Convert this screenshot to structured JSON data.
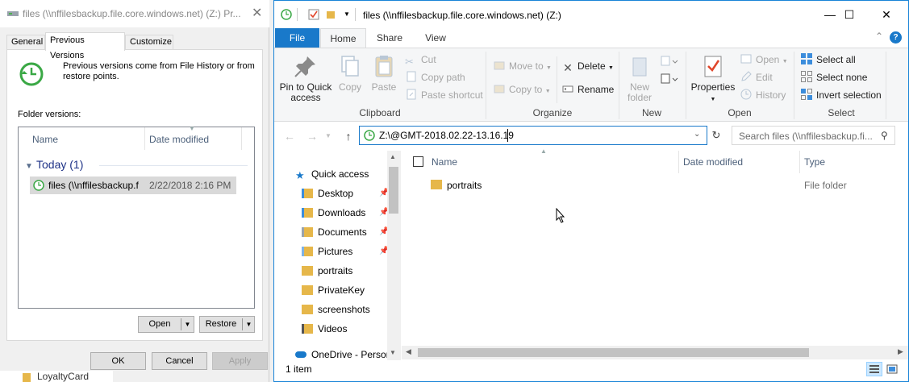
{
  "props": {
    "title": "files (\\\\nffilesbackup.file.core.windows.net) (Z:) Pr...",
    "tabs": [
      {
        "label": "General"
      },
      {
        "label": "Previous Versions"
      },
      {
        "label": "Customize"
      }
    ],
    "description": "Previous versions come from File History or from restore points.",
    "folder_versions_label": "Folder versions:",
    "columns": {
      "name": "Name",
      "date": "Date modified"
    },
    "group": {
      "label": "Today (1)"
    },
    "version_row": {
      "name": "files (\\\\nffilesbackup.file.core.windows.net)",
      "date": "2/22/2018 2:16 PM"
    },
    "open_label": "Open",
    "restore_label": "Restore",
    "ok_label": "OK",
    "cancel_label": "Cancel",
    "apply_label": "Apply",
    "under_label": "LoyaltyCard"
  },
  "explorer": {
    "title": "files (\\\\nffilesbackup.file.core.windows.net) (Z:)",
    "window_buttons": {
      "minimize": "—",
      "maximize": "☐",
      "close": "✕"
    },
    "tabs": [
      {
        "label": "File"
      },
      {
        "label": "Home"
      },
      {
        "label": "Share"
      },
      {
        "label": "View"
      }
    ],
    "ribbon": {
      "pin_label": "Pin to Quick access",
      "copy_label": "Copy",
      "paste_label": "Paste",
      "cut_label": "Cut",
      "copy_path_label": "Copy path",
      "paste_shortcut_label": "Paste shortcut",
      "clipboard_group": "Clipboard",
      "move_to_label": "Move to",
      "copy_to_label": "Copy to",
      "delete_label": "Delete",
      "rename_label": "Rename",
      "organize_group": "Organize",
      "new_folder_label": "New folder",
      "new_group": "New",
      "properties_label": "Properties",
      "open_label": "Open",
      "edit_label": "Edit",
      "history_label": "History",
      "open_group": "Open",
      "select_all_label": "Select all",
      "select_none_label": "Select none",
      "invert_selection_label": "Invert selection",
      "select_group": "Select"
    },
    "address": "Z:\\@GMT-2018.02.22-13.16.19",
    "search_placeholder": "Search files (\\\\nffilesbackup.fi...",
    "nav": [
      {
        "label": "Quick access",
        "icon": "star-icon"
      },
      {
        "label": "Desktop",
        "icon": "desktop-folder-icon",
        "pinned": true
      },
      {
        "label": "Downloads",
        "icon": "downloads-folder-icon",
        "pinned": true
      },
      {
        "label": "Documents",
        "icon": "documents-folder-icon",
        "pinned": true
      },
      {
        "label": "Pictures",
        "icon": "pictures-folder-icon",
        "pinned": true
      },
      {
        "label": "portraits",
        "icon": "folder-icon"
      },
      {
        "label": "PrivateKey",
        "icon": "folder-icon"
      },
      {
        "label": "screenshots",
        "icon": "folder-icon"
      },
      {
        "label": "Videos",
        "icon": "videos-folder-icon"
      },
      {
        "label": "OneDrive - Person",
        "icon": "onedrive-cloud-icon"
      }
    ],
    "columns": {
      "name": "Name",
      "date": "Date modified",
      "type": "Type"
    },
    "files": [
      {
        "name": "portraits",
        "date": "",
        "type": "File folder"
      }
    ],
    "status": "1 item"
  },
  "colors": {
    "accent": "#1979ca",
    "folder": "#e6b74a",
    "ribbon_bg": "#f5f6f7"
  }
}
